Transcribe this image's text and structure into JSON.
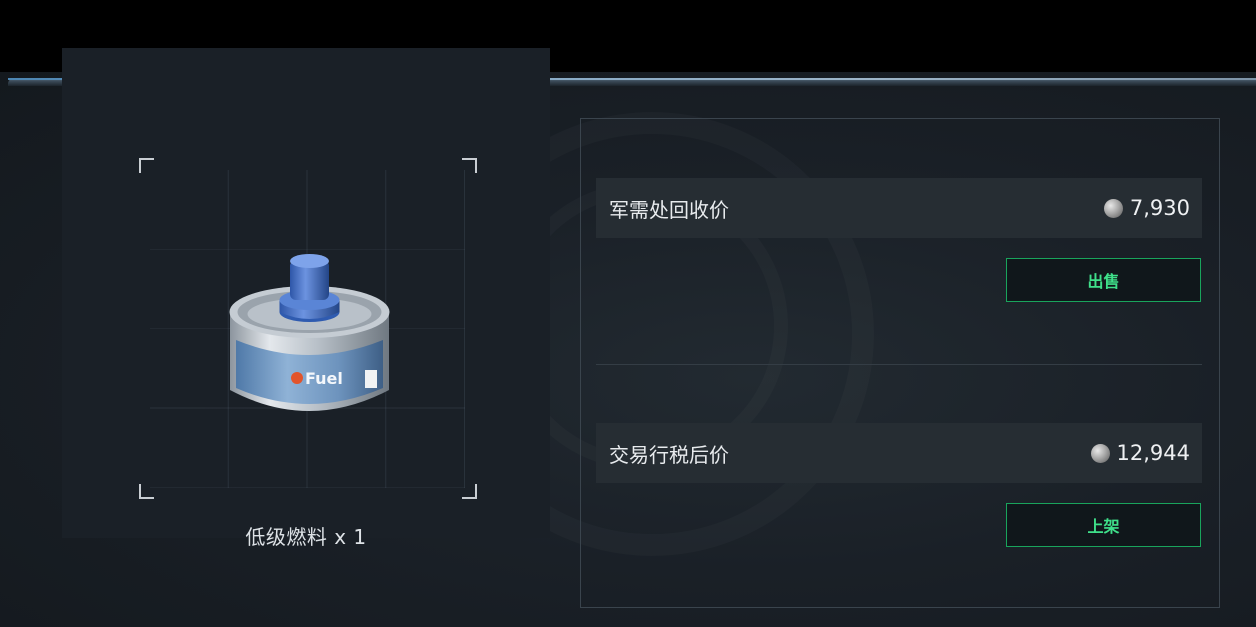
{
  "item": {
    "name": "低级燃料 x 1",
    "image_label": "Fuel"
  },
  "recycle": {
    "label": "军需处回收价",
    "price": "7,930",
    "button_label": "出售"
  },
  "market": {
    "label": "交易行税后价",
    "price": "12,944",
    "button_label": "上架"
  },
  "icons": {
    "currency": "coin-icon",
    "item": "fuel-can-icon"
  },
  "colors": {
    "accent_green": "#3fe08a",
    "button_border": "#19a45c"
  }
}
